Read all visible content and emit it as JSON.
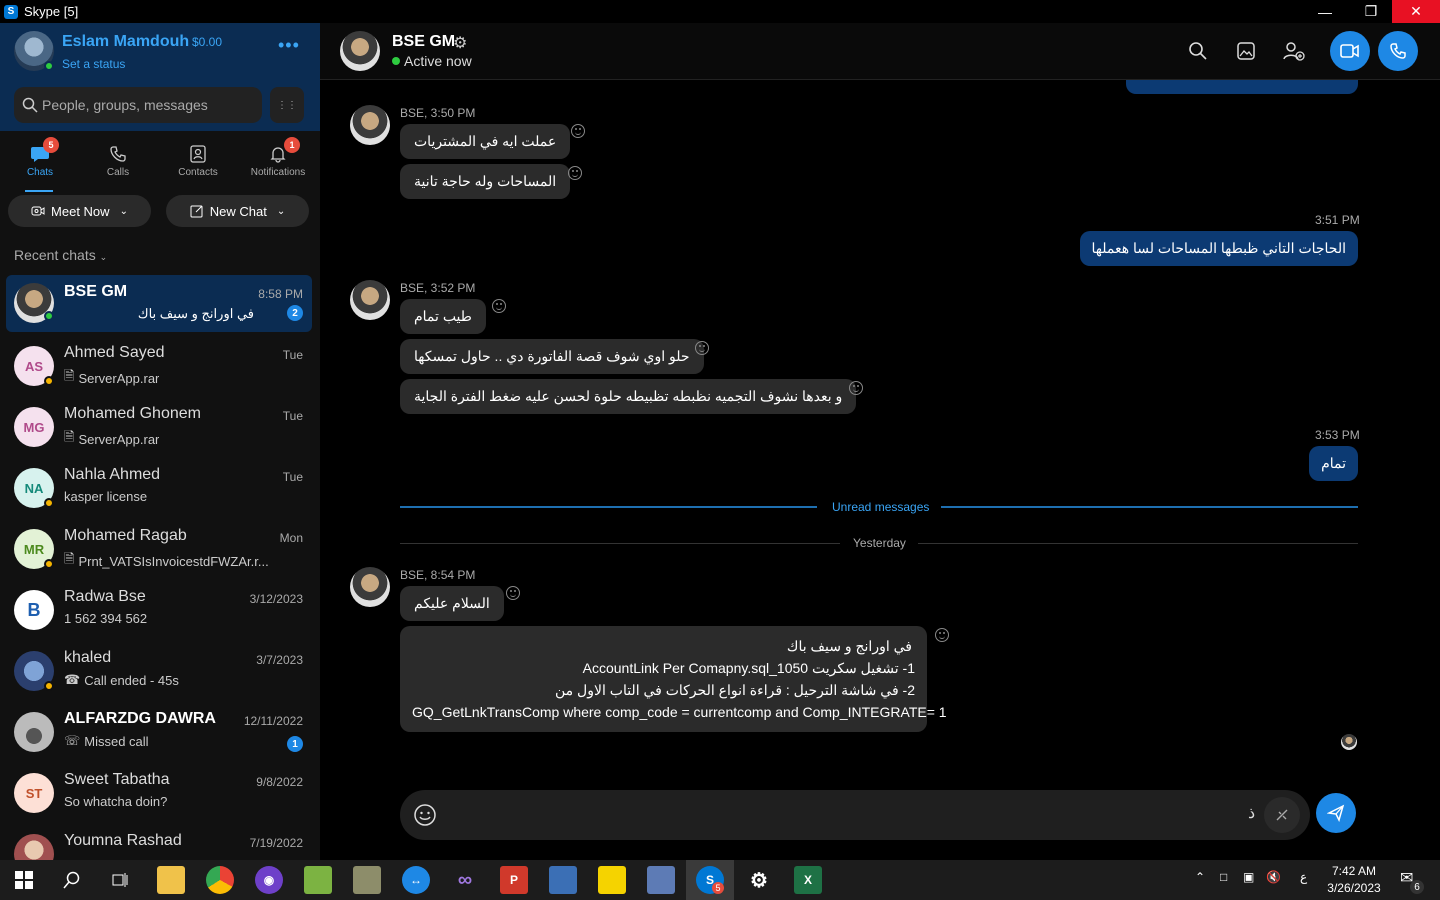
{
  "window": {
    "title": "Skype [5]"
  },
  "profile": {
    "name": "Eslam Mamdouh",
    "credit": "$0.00",
    "status_prompt": "Set a status",
    "search_placeholder": "People, groups, messages"
  },
  "nav": [
    {
      "label": "Chats",
      "badge": "5",
      "icon": "chat-icon"
    },
    {
      "label": "Calls",
      "badge": "",
      "icon": "phone-icon"
    },
    {
      "label": "Contacts",
      "badge": "",
      "icon": "contacts-icon"
    },
    {
      "label": "Notifications",
      "badge": "1",
      "icon": "bell-icon"
    }
  ],
  "actions": {
    "meet_now": "Meet Now",
    "new_chat": "New Chat"
  },
  "recent_label": "Recent chats",
  "chats": [
    {
      "name": "BSE GM",
      "time": "8:58 PM",
      "preview": "في اورانج و سيف باك",
      "unread": "2",
      "initials": "",
      "status": "online"
    },
    {
      "name": "Ahmed Sayed",
      "time": "Tue",
      "preview": "ServerApp.rar",
      "unread": "",
      "initials": "AS",
      "status": "away"
    },
    {
      "name": "Mohamed Ghonem",
      "time": "Tue",
      "preview": "ServerApp.rar",
      "unread": "",
      "initials": "MG",
      "status": ""
    },
    {
      "name": "Nahla Ahmed",
      "time": "Tue",
      "preview": "kasper license",
      "unread": "",
      "initials": "NA",
      "status": "away"
    },
    {
      "name": "Mohamed Ragab",
      "time": "Mon",
      "preview": "Prnt_VATSIsInvoicestdFWZAr.r...",
      "unread": "",
      "initials": "MR",
      "status": "away"
    },
    {
      "name": "Radwa Bse",
      "time": "3/12/2023",
      "preview": "1 562 394 562",
      "unread": "",
      "initials": "",
      "status": ""
    },
    {
      "name": "khaled",
      "time": "3/7/2023",
      "preview": "Call ended - 45s",
      "unread": "",
      "initials": "",
      "status": "away"
    },
    {
      "name": "ALFARZDG DAWRA",
      "time": "12/11/2022",
      "preview": "Missed call",
      "unread": "1",
      "initials": "",
      "status": ""
    },
    {
      "name": "Sweet Tabatha",
      "time": "9/8/2022",
      "preview": "So whatcha doin?",
      "unread": "",
      "initials": "ST",
      "status": ""
    },
    {
      "name": "Youmna Rashad",
      "time": "7/19/2022",
      "preview": "",
      "unread": "",
      "initials": "",
      "status": ""
    }
  ],
  "conversation": {
    "name": "BSE GM",
    "presence": "Active now",
    "groups": [
      {
        "sender": "BSE, 3:50 PM",
        "messages": [
          "عملت ايه في المشتريات",
          "المساحات وله حاجة تانية"
        ]
      },
      {
        "sender": "BSE, 3:52 PM",
        "messages": [
          "طيب تمام",
          "حلو اوي شوف قصة الفاتورة دي .. حاول تمسكها",
          "و بعدها نشوف التجميه نظبطه تظبيطه حلوة لحسن عليه ضغط الفترة الجاية"
        ]
      },
      {
        "sender": "BSE, 8:54 PM",
        "messages": [
          "السلام عليكم"
        ]
      }
    ],
    "outgoing": [
      {
        "time": "3:51 PM",
        "text": "الحاجات التاني ظبطها المساحات لسا  هعملها"
      },
      {
        "time": "3:53 PM",
        "text": "تمام"
      }
    ],
    "multiline": [
      "في اورانج و سيف باك",
      "1- تشغيل سكريت AccountLink Per Comapny.sql_1050",
      "2- في شاشة الترحيل : قراءة انواع الحركات في التاب الاول من",
      "GQ_GetLnkTransComp where comp_code = currentcomp and Comp_INTEGRATE= 1"
    ],
    "unread_divider": "Unread messages",
    "day_divider": "Yesterday",
    "composer_text": "ذ"
  },
  "taskbar": {
    "clock_time": "7:42 AM",
    "clock_date": "3/26/2023",
    "lang": "ع",
    "notif_count": "6",
    "skype_badge": "5"
  },
  "colors": {
    "accent": "#1e88e5",
    "outgoing_bubble": "#0c3a73",
    "incoming_bubble": "#2b2b2b",
    "online": "#2ecc40",
    "away": "#f5b400"
  }
}
